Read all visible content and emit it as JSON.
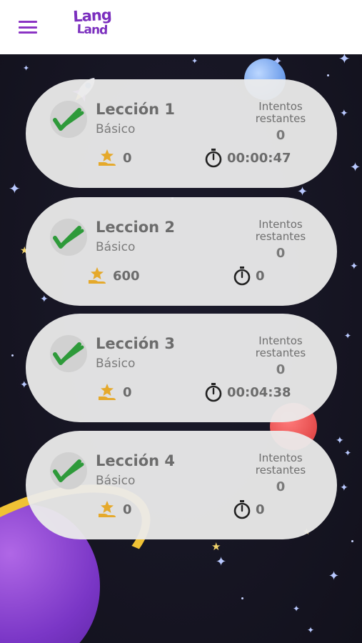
{
  "app": {
    "logo_line1": "Lang",
    "logo_line2": "Land"
  },
  "colors": {
    "accent": "#8b34c4",
    "card_bg": "#ebebeb",
    "check_green": "#2e9a3a",
    "medal_gold": "#e5a92b",
    "space_bg": "#161522"
  },
  "header": {
    "menu_icon": "hamburger-menu-icon"
  },
  "lessons": [
    {
      "title": "Lección 1",
      "level": "Básico",
      "attempts_label_1": "Intentos",
      "attempts_label_2": "restantes",
      "attempts_value": "0",
      "points": "0",
      "time": "00:00:47"
    },
    {
      "title": "Leccion 2",
      "level": "Básico",
      "attempts_label_1": "Intentos",
      "attempts_label_2": "restantes",
      "attempts_value": "0",
      "points": "600",
      "time": "0"
    },
    {
      "title": "Lección 3",
      "level": "Básico",
      "attempts_label_1": "Intentos",
      "attempts_label_2": "restantes",
      "attempts_value": "0",
      "points": "0",
      "time": "00:04:38"
    },
    {
      "title": "Lección 4",
      "level": "Básico",
      "attempts_label_1": "Intentos",
      "attempts_label_2": "restantes",
      "attempts_value": "0",
      "points": "0",
      "time": "0"
    }
  ]
}
